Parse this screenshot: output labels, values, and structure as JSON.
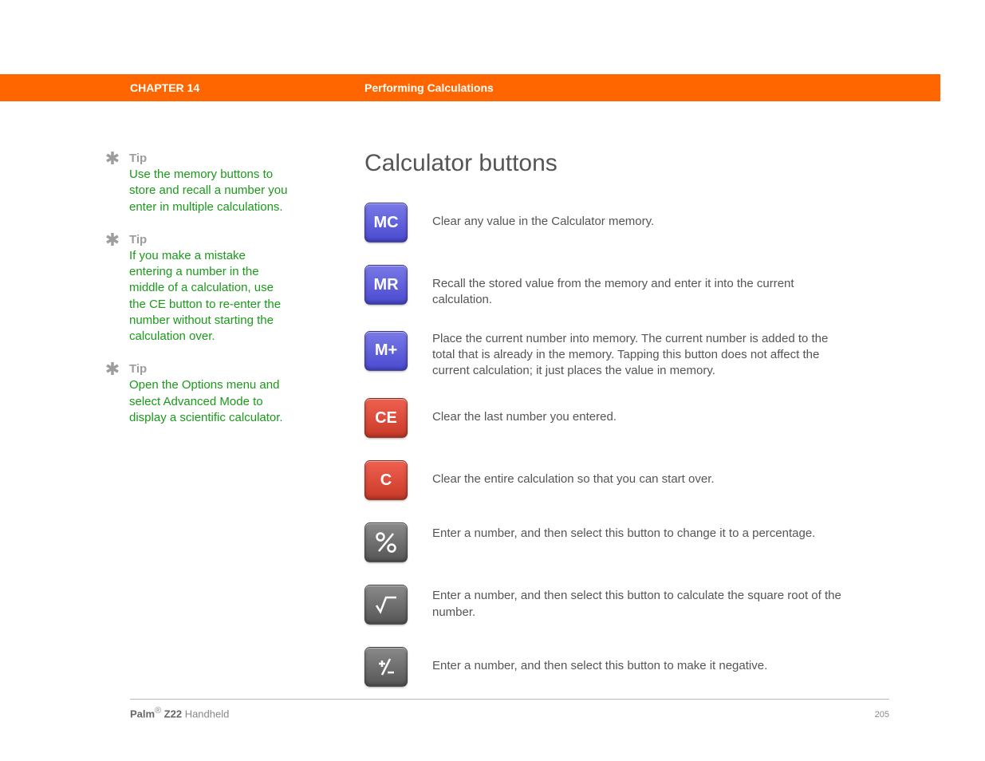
{
  "header": {
    "chapter": "CHAPTER 14",
    "title": "Performing Calculations"
  },
  "sidebar": {
    "tips": [
      {
        "label": "Tip",
        "body": "Use the memory buttons to store and recall a number you enter in multiple calculations."
      },
      {
        "label": "Tip",
        "body": "If you make a mistake entering a number in the middle of a calculation, use the CE button to re-enter the number without starting the calculation over."
      },
      {
        "label": "Tip",
        "body": "Open the Options menu and select Advanced Mode to display a scientific calculator."
      }
    ]
  },
  "main": {
    "heading": "Calculator buttons",
    "buttons": [
      {
        "label": "MC",
        "color": "blue",
        "desc": "Clear any value in the Calculator memory."
      },
      {
        "label": "MR",
        "color": "blue",
        "desc": "Recall the stored value from the memory and enter it into the current calculation."
      },
      {
        "label": "M+",
        "color": "blue",
        "desc": "Place the current number into memory. The current number is added to the total that is already in the memory. Tapping this button does not affect the current calculation; it just places the value in memory."
      },
      {
        "label": "CE",
        "color": "red",
        "desc": "Clear the last number you entered."
      },
      {
        "label": "C",
        "color": "red",
        "desc": "Clear the entire calculation so that you can start over."
      },
      {
        "label": "%",
        "color": "gray",
        "desc": "Enter a number, and then select this button to change it to a percentage."
      },
      {
        "label": "√",
        "color": "gray",
        "desc": "Enter a number, and then select this button to calculate the square root of the number."
      },
      {
        "label": "±",
        "color": "gray",
        "desc": "Enter a number, and then select this button to make it negative."
      }
    ]
  },
  "footer": {
    "brand_bold": "Palm",
    "brand_reg": "®",
    "brand_model": " Z22",
    "brand_suffix": " Handheld",
    "page": "205"
  }
}
